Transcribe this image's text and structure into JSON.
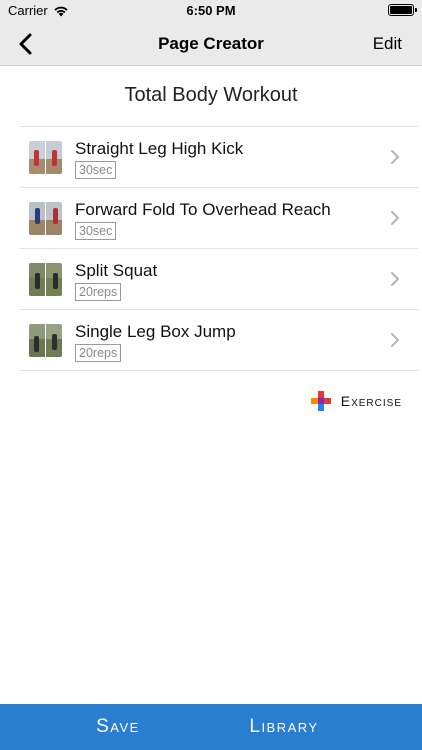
{
  "status_bar": {
    "carrier": "Carrier",
    "time": "6:50 PM",
    "wifi_icon": "wifi-icon",
    "battery_icon": "battery-icon"
  },
  "nav": {
    "back_icon": "chevron-left-icon",
    "title": "Page Creator",
    "edit_label": "Edit"
  },
  "page_title": "Total Body Workout",
  "exercises": [
    {
      "name": "Straight Leg High Kick",
      "amount": "30sec"
    },
    {
      "name": "Forward Fold To Overhead Reach",
      "amount": "30sec"
    },
    {
      "name": "Split Squat",
      "amount": "20reps"
    },
    {
      "name": "Single Leg Box Jump",
      "amount": "20reps"
    }
  ],
  "add_exercise": {
    "icon": "color-plus-icon",
    "label": "Exercise"
  },
  "bottom": {
    "save_label": "Save",
    "library_label": "Library"
  },
  "colors": {
    "bottom_bar": "#2a7ed2",
    "nav_bg": "#eaeaea"
  }
}
